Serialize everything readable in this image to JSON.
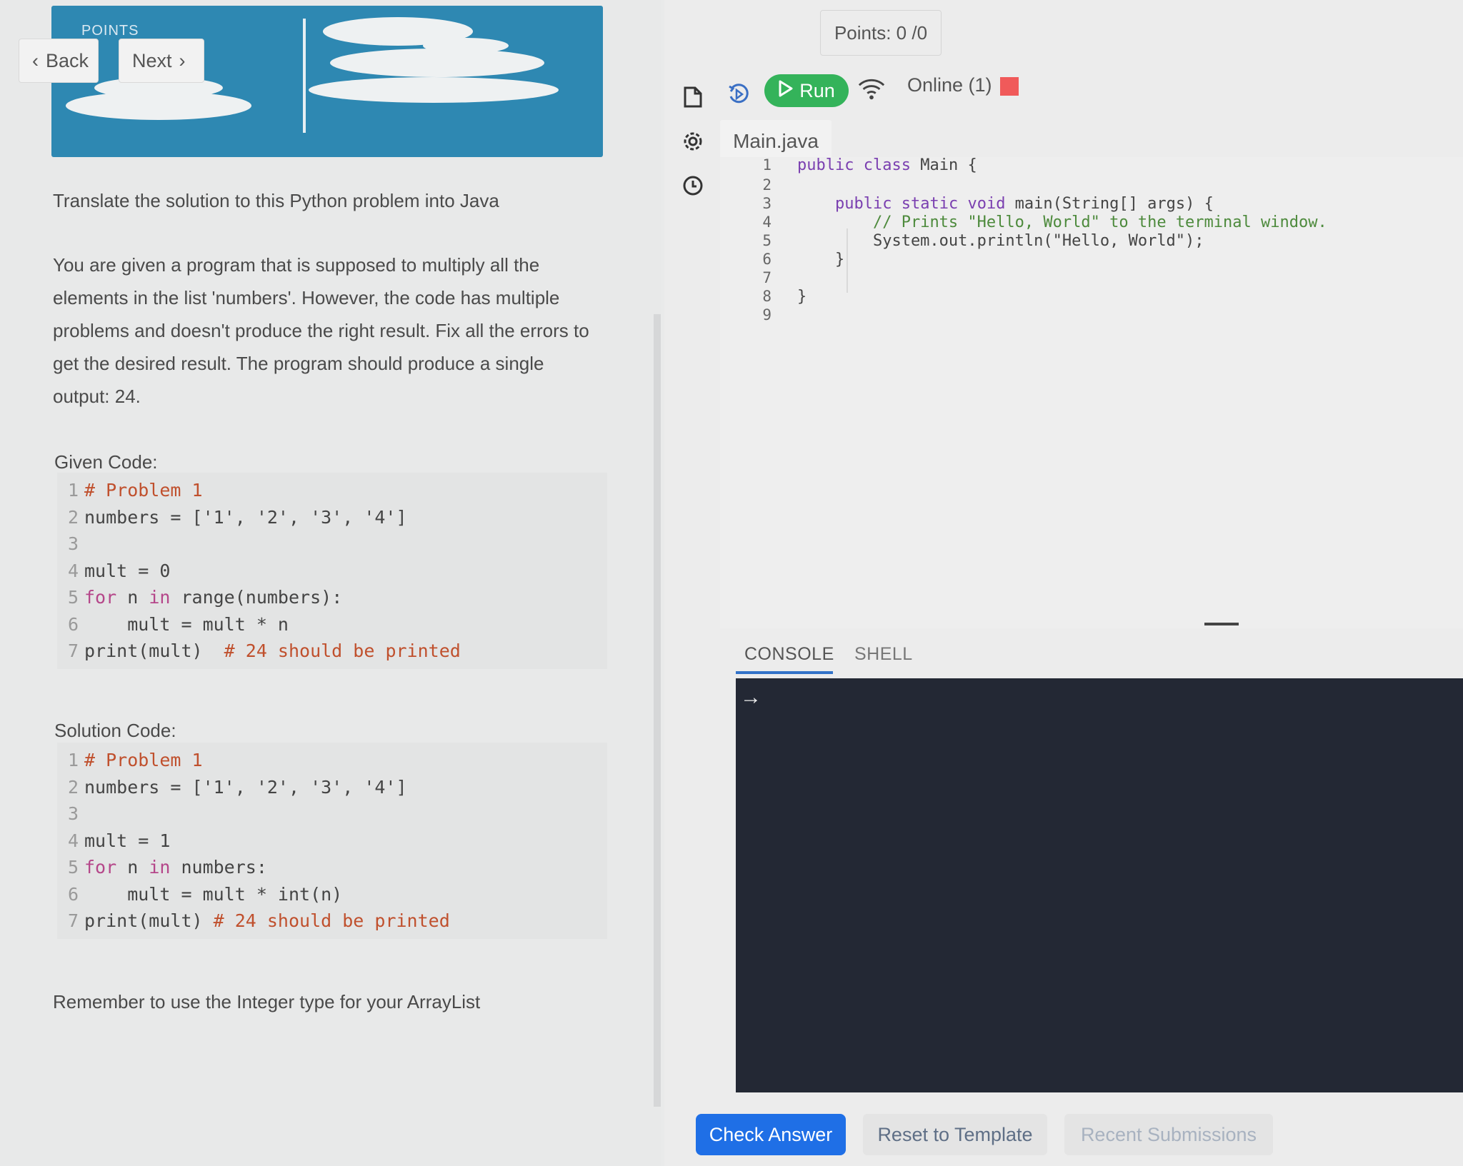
{
  "banner": {
    "label": "POINTS"
  },
  "nav": {
    "back_label": "Back",
    "next_label": "Next"
  },
  "instructions": {
    "intro": "Translate the solution to this Python problem into Java",
    "body_lines": [
      "You are given a program that is supposed to multiply all the",
      "elements in the list 'numbers'. However, the code has multiple",
      "problems and doesn't produce the right result. Fix all the errors to",
      "get the desired result. The program should produce a single",
      "output: 24."
    ],
    "given_label": "Given Code:",
    "given_code": [
      {
        "n": "1",
        "text": "# Problem 1"
      },
      {
        "n": "2",
        "text": "numbers = ['1', '2', '3', '4']"
      },
      {
        "n": "3",
        "text": ""
      },
      {
        "n": "4",
        "text": "mult = 0"
      },
      {
        "n": "5",
        "text": "for n in range(numbers):"
      },
      {
        "n": "6",
        "text": "    mult = mult * n"
      },
      {
        "n": "7",
        "text": "print(mult)  # 24 should be printed"
      }
    ],
    "solution_label": "Solution Code:",
    "solution_code": [
      {
        "n": "1",
        "text": "# Problem 1"
      },
      {
        "n": "2",
        "text": "numbers = ['1', '2', '3', '4']"
      },
      {
        "n": "3",
        "text": ""
      },
      {
        "n": "4",
        "text": "mult = 1"
      },
      {
        "n": "5",
        "text": "for n in numbers:"
      },
      {
        "n": "6",
        "text": "    mult = mult * int(n)"
      },
      {
        "n": "7",
        "text": "print(mult) # 24 should be printed"
      }
    ],
    "reminder": "Remember to use the Integer type for your ArrayList"
  },
  "header": {
    "points": "Points: 0 /0"
  },
  "toolbar": {
    "run_label": "Run",
    "status_label": "Online (1)",
    "stop_color": "#f05a5a",
    "run_color": "#34b35a",
    "icons": [
      "file-icon",
      "history-run-icon",
      "play-icon",
      "wifi-icon",
      "settings-icon",
      "clock-icon"
    ]
  },
  "editor": {
    "filename": "Main.java",
    "lines": [
      {
        "n": "1",
        "text": "public class Main {"
      },
      {
        "n": "2",
        "text": ""
      },
      {
        "n": "3",
        "text": "    public static void main(String[] args) {"
      },
      {
        "n": "4",
        "text": "        // Prints \"Hello, World\" to the terminal window."
      },
      {
        "n": "5",
        "text": "        System.out.println(\"Hello, World\");"
      },
      {
        "n": "6",
        "text": "    }"
      },
      {
        "n": "7",
        "text": ""
      },
      {
        "n": "8",
        "text": "}"
      },
      {
        "n": "9",
        "text": ""
      }
    ]
  },
  "console": {
    "tab_console": "CONSOLE",
    "tab_shell": "SHELL",
    "prompt": "→"
  },
  "actions": {
    "check": "Check Answer",
    "reset": "Reset to Template",
    "recent": "Recent Submissions",
    "accent": "#1f6fe6"
  }
}
